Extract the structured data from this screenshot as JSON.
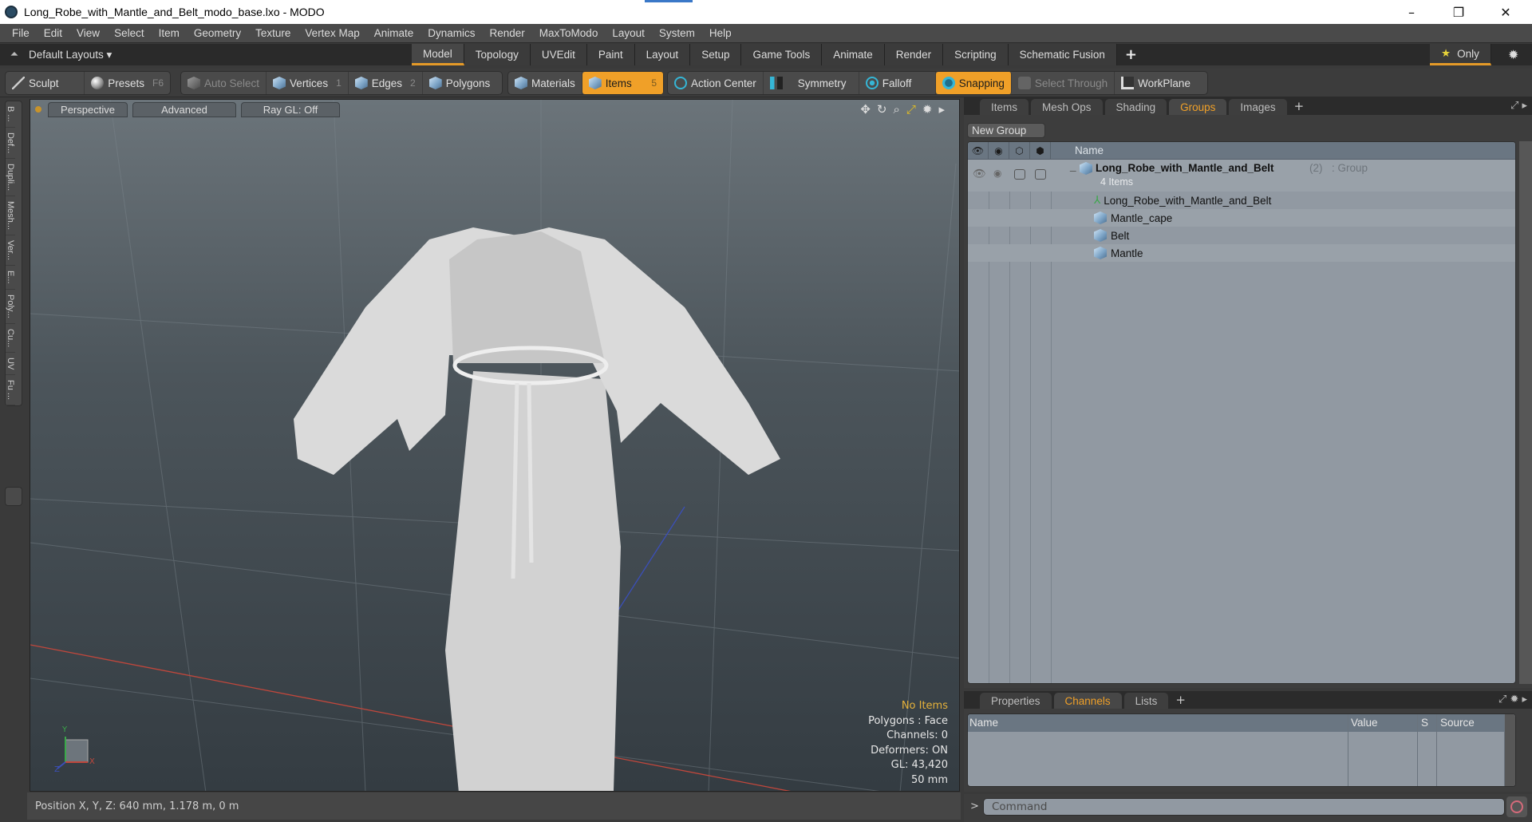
{
  "window": {
    "title": "Long_Robe_with_Mantle_and_Belt_modo_base.lxo - MODO",
    "controls": {
      "minimize": "–",
      "restore": "❐",
      "close": "✕"
    }
  },
  "menu": [
    "File",
    "Edit",
    "View",
    "Select",
    "Item",
    "Geometry",
    "Texture",
    "Vertex Map",
    "Animate",
    "Dynamics",
    "Render",
    "MaxToModo",
    "Layout",
    "System",
    "Help"
  ],
  "layoutbar": {
    "layouts_label": "Default Layouts ▾",
    "tabs": [
      "Model",
      "Topology",
      "UVEdit",
      "Paint",
      "Layout",
      "Setup",
      "Game Tools",
      "Animate",
      "Render",
      "Scripting",
      "Schematic Fusion"
    ],
    "active_tab": "Model",
    "add": "+",
    "only_label": "Only"
  },
  "toolbar": {
    "sculpt": "Sculpt",
    "presets": "Presets",
    "presets_key": "F6",
    "auto_select": "Auto Select",
    "vertices": "Vertices",
    "vertices_key": "1",
    "edges": "Edges",
    "edges_key": "2",
    "polygons": "Polygons",
    "materials": "Materials",
    "items": "Items",
    "items_key": "5",
    "action_center": "Action Center",
    "symmetry": "Symmetry",
    "falloff": "Falloff",
    "snapping": "Snapping",
    "select_through": "Select Through",
    "workplane": "WorkPlane"
  },
  "left_tray": [
    "B ...",
    "Def...",
    "Dupli...",
    "Mesh...",
    "Ver...",
    "E...",
    "Poly...",
    "Cu...",
    "UV",
    "Fu ..."
  ],
  "viewport": {
    "view": "Perspective",
    "mode": "Advanced",
    "raygl": "Ray GL: Off",
    "hud": {
      "selection": "No Items",
      "polygons": "Polygons : Face",
      "channels": "Channels: 0",
      "deformers": "Deformers: ON",
      "gl": "GL: 43,420",
      "grid": "50 mm"
    },
    "axis": {
      "x": "X",
      "y": "Y",
      "z": "Z"
    }
  },
  "statusbar": {
    "position": "Position X, Y, Z:   640 mm, 1.178 m, 0 m"
  },
  "groups_panel": {
    "tabs": [
      "Items",
      "Mesh Ops",
      "Shading",
      "Groups",
      "Images"
    ],
    "active_tab": "Groups",
    "add": "+",
    "new_group": "New Group",
    "column_name": "Name",
    "group": {
      "name": "Long_Robe_with_Mantle_and_Belt",
      "count": "(2)",
      "type": ": Group",
      "items_label": "4 Items"
    },
    "children": [
      {
        "name": "Long_Robe_with_Mantle_and_Belt",
        "icon": "locator-icon"
      },
      {
        "name": "Mantle_cape",
        "icon": "mesh-icon"
      },
      {
        "name": "Belt",
        "icon": "mesh-icon"
      },
      {
        "name": "Mantle",
        "icon": "mesh-icon"
      }
    ]
  },
  "channels_panel": {
    "tabs": [
      "Properties",
      "Channels",
      "Lists"
    ],
    "active_tab": "Channels",
    "add": "+",
    "columns": [
      "Name",
      "Value",
      "S",
      "Source"
    ]
  },
  "command": {
    "prompt": ">",
    "placeholder": "Command"
  },
  "colors": {
    "accent": "#f0a028",
    "hud_highlight": "#e6b23a"
  }
}
